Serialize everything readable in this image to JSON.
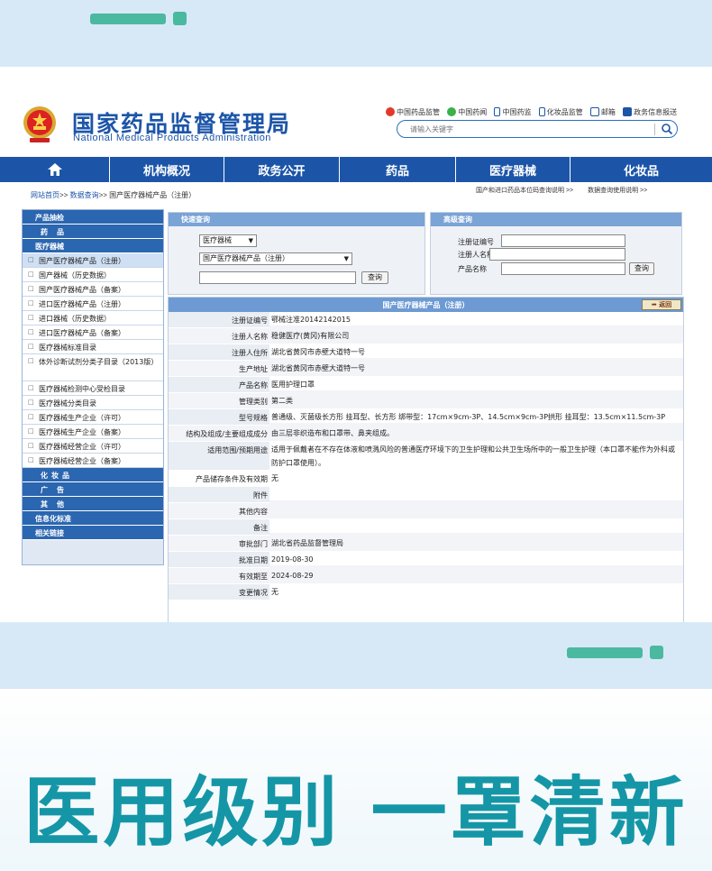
{
  "slogan": "医用级别 一罩清新",
  "header": {
    "title_cn": "国家药品监督管理局",
    "title_en": "National Medical Products Administration",
    "top_links": [
      "中国药品监管",
      "中国药闻",
      "中国药监",
      "化妆品监管",
      "邮箱",
      "政务信息报送"
    ],
    "search_placeholder": "请输入关键字"
  },
  "nav": [
    "",
    "机构概况",
    "政务公开",
    "药品",
    "医疗器械",
    "化妆品"
  ],
  "breadcrumb": {
    "home": "网站首页",
    "sep": ">>",
    "query": "数据查询",
    "current": "国产医疗器械产品（注册）"
  },
  "right_links": [
    "国产和进口药品本位码查询说明 >>",
    "数据查询使用说明 >>"
  ],
  "sidebar": {
    "cat_products": "产品抽检",
    "cat_drugs": "药品",
    "cat_devices": "医疗器械",
    "items": [
      "国产医疗器械产品（注册）",
      "国产器械（历史数据）",
      "国产医疗器械产品（备案）",
      "进口医疗器械产品（注册）",
      "进口器械（历史数据）",
      "进口医疗器械产品（备案）",
      "医疗器械标准目录",
      "体外诊断试剂分类子目录（2013版）",
      "医疗器械检测中心受检目录",
      "医疗器械分类目录",
      "医疗器械生产企业（许可）",
      "医疗器械生产企业（备案）",
      "医疗器械经营企业（许可）",
      "医疗器械经营企业（备案）"
    ],
    "cat_cosmetics": "化妆品",
    "cat_ads": "广告",
    "cat_other": "其他",
    "cat_info": "信息化标准",
    "cat_links": "相关链接"
  },
  "quick": {
    "title": "快速查询",
    "select1": "医疗器械",
    "select2": "国产医疗器械产品（注册）",
    "button": "查询"
  },
  "advanced": {
    "title": "高级查询",
    "label1": "注册证编号",
    "label2": "注册人名称",
    "label3": "产品名称",
    "button": "查询"
  },
  "detail": {
    "title": "国产医疗器械产品（注册）",
    "back": "返回",
    "rows": [
      {
        "label": "注册证编号",
        "value": "鄂械注准20142142015"
      },
      {
        "label": "注册人名称",
        "value": "稳健医疗(黄冈)有限公司"
      },
      {
        "label": "注册人住所",
        "value": "湖北省黄冈市赤壁大道特一号"
      },
      {
        "label": "生产地址",
        "value": "湖北省黄冈市赤壁大道特一号"
      },
      {
        "label": "产品名称",
        "value": "医用护理口罩"
      },
      {
        "label": "管理类别",
        "value": "第二类"
      },
      {
        "label": "型号规格",
        "value": "普通级、灭菌级长方形 挂耳型、长方形 绑带型：17cm×9cm-3P、14.5cm×9cm-3P拱形 挂耳型：13.5cm×11.5cm-3P"
      },
      {
        "label": "结构及组成/主要组成成分",
        "value": "由三层非织造布和口罩带、鼻夹组成。"
      },
      {
        "label": "适用范围/预期用途",
        "value": "适用于佩戴者在不存在体液和喷溅风险的普通医疗环境下的卫生护理和公共卫生场所中的一般卫生护理（本口罩不能作为外科或防护口罩使用）。"
      },
      {
        "label": "产品储存条件及有效期",
        "value": "无"
      },
      {
        "label": "附件",
        "value": ""
      },
      {
        "label": "其他内容",
        "value": ""
      },
      {
        "label": "备注",
        "value": ""
      },
      {
        "label": "审批部门",
        "value": "湖北省药品监督管理局"
      },
      {
        "label": "批准日期",
        "value": "2019-08-30"
      },
      {
        "label": "有效期至",
        "value": "2024-08-29"
      },
      {
        "label": "变更情况",
        "value": "无"
      }
    ]
  },
  "colors": {
    "brand_blue": "#1c55a8",
    "accent_teal": "#4bb8a0",
    "slogan_color": "#1596a6",
    "band_bg": "#d7e9f7"
  }
}
